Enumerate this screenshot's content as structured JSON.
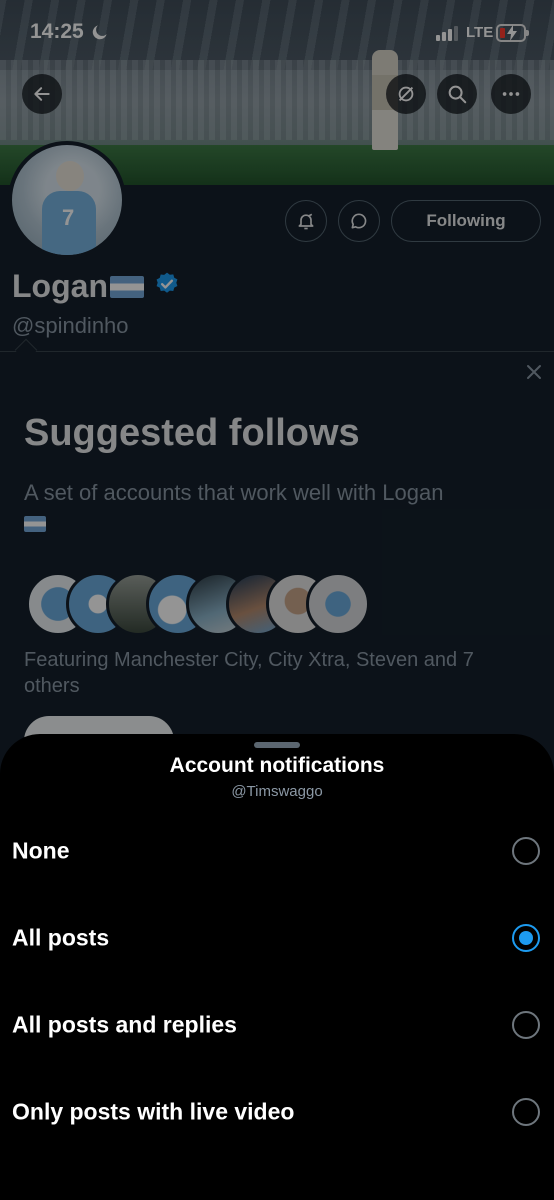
{
  "status_bar": {
    "time": "14:25",
    "network": "LTE",
    "icons": [
      "moon-icon",
      "signal-icon",
      "battery-charging-icon"
    ]
  },
  "profile": {
    "name": "Logan",
    "handle": "@spindinho",
    "following_label": "Following",
    "verified": true,
    "header_icons": [
      "back-arrow-icon",
      "incognito-icon",
      "search-icon",
      "more-icon"
    ],
    "action_icons": [
      "notification-bell-icon",
      "message-icon"
    ]
  },
  "suggested": {
    "title": "Suggested follows",
    "description": "A set of accounts that work well with Logan",
    "featuring": "Featuring Manchester City, City Xtra, Steven and 7 others"
  },
  "sheet": {
    "title": "Account notifications",
    "subtitle": "@Timswaggo",
    "options": [
      {
        "label": "None",
        "selected": false
      },
      {
        "label": "All posts",
        "selected": true
      },
      {
        "label": "All posts and replies",
        "selected": false
      },
      {
        "label": "Only posts with live video",
        "selected": false
      }
    ]
  },
  "colors": {
    "accent": "#1d9bf0",
    "background": "#000000",
    "profile_bg": "#15202b",
    "muted_text": "#8b98a5"
  }
}
